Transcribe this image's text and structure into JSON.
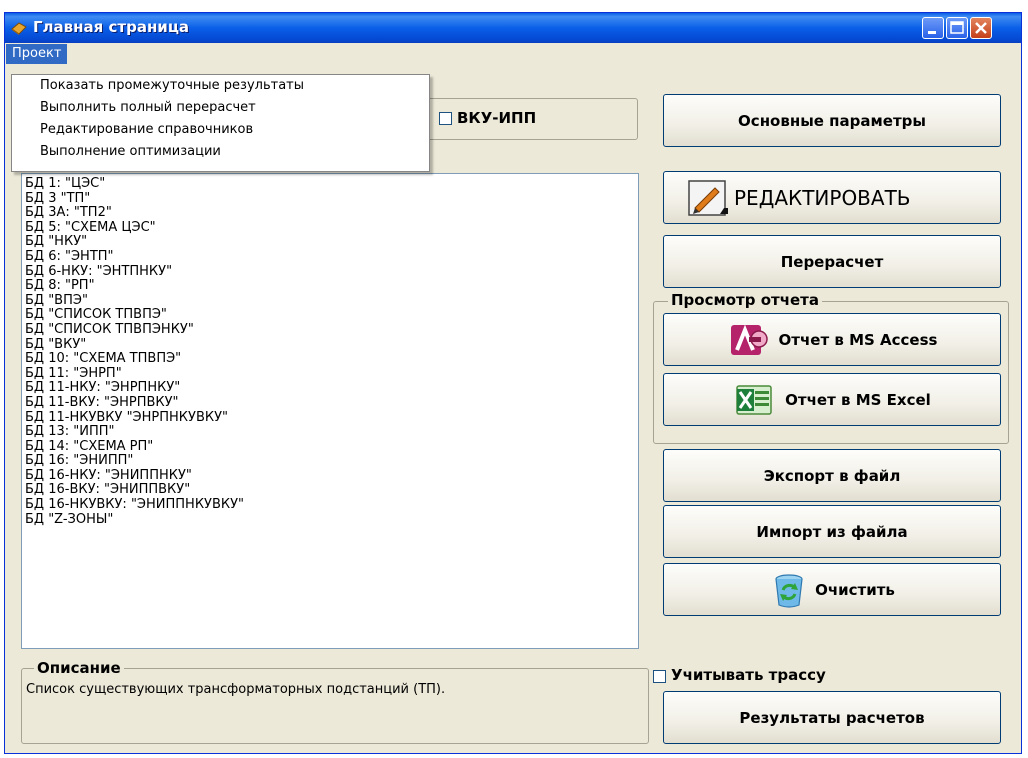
{
  "window": {
    "title": "Главная страница"
  },
  "menu": {
    "project_label": "Проект",
    "items": [
      "Показать промежуточные результаты",
      "Выполнить полный перерасчет",
      "Редактирование справочников",
      "Выполнение оптимизации"
    ]
  },
  "vku_ipp": {
    "label": "ВКУ-ИПП",
    "checked": false
  },
  "db_list": [
    "БД 1: \"ЦЭС\"",
    "БД 3 \"ТП\"",
    "БД 3А: \"ТП2\"",
    "БД 5: \"СХЕМА ЦЭС\"",
    "БД \"НКУ\"",
    "БД 6: \"ЭНТП\"",
    "БД 6-НКУ: \"ЭНТПНКУ\"",
    "БД 8: \"РП\"",
    "БД \"ВПЭ\"",
    "БД \"СПИСОК ТПВПЭ\"",
    "БД \"СПИСОК ТПВПЭНКУ\"",
    "БД \"ВКУ\"",
    "БД 10: \"СХЕМА ТПВПЭ\"",
    "БД 11: \"ЭНРП\"",
    "БД 11-НКУ: \"ЭНРПНКУ\"",
    "БД 11-ВКУ: \"ЭНРПВКУ\"",
    "БД 11-НКУВКУ \"ЭНРПНКУВКУ\"",
    "БД 13: \"ИПП\"",
    "БД 14: \"СХЕМА РП\"",
    "БД 16: \"ЭНИПП\"",
    "БД 16-НКУ: \"ЭНИППНКУ\"",
    "БД 16-ВКУ: \"ЭНИППВКУ\"",
    "БД 16-НКУВКУ: \"ЭНИППНКУВКУ\"",
    "БД \"Z-ЗОНЫ\""
  ],
  "description": {
    "legend": "Описание",
    "text": "Список существующих трансформаторных подстанций (ТП)."
  },
  "buttons": {
    "main_params": "Основные параметры",
    "edit": "РЕДАКТИРОВАТЬ",
    "recalc": "Перерасчет",
    "export": "Экспорт в файл",
    "import": "Импорт из файла",
    "clear": "Очистить",
    "results": "Результаты расчетов"
  },
  "report": {
    "legend": "Просмотр отчета",
    "access": "Отчет в MS Access",
    "excel": "Отчет в MS Excel"
  },
  "track": {
    "label": "Учитывать трассу",
    "checked": false
  },
  "colors": {
    "titlebar": "#0a5fe8",
    "window_bg": "#ece9d8",
    "menu_highlight": "#316ac5",
    "button_border": "#003c74"
  }
}
